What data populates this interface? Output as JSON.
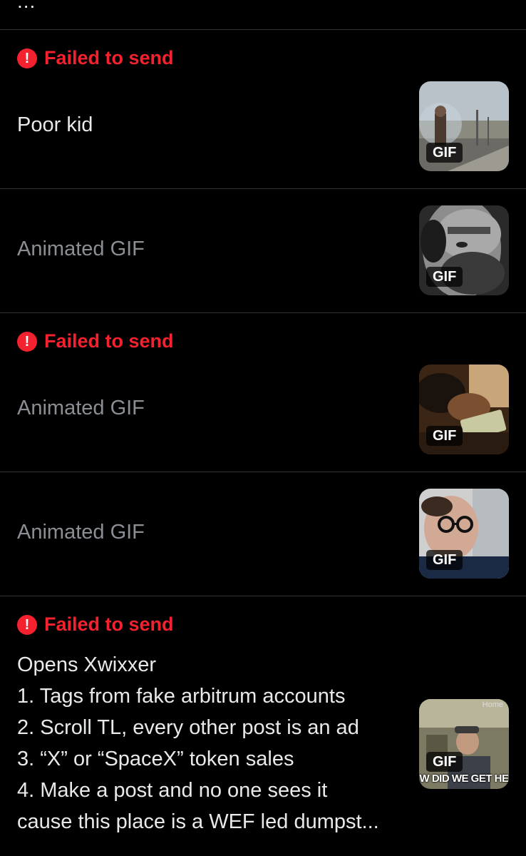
{
  "top": {
    "ellipsis": "..."
  },
  "messages": [
    {
      "failed_label": "Failed to send",
      "text": "Poor kid",
      "gif_badge": "GIF",
      "thumb_icon": "man-with-bubble-gif"
    },
    {
      "text": "Animated GIF",
      "gif_badge": "GIF",
      "thumb_icon": "bearded-man-gif"
    },
    {
      "failed_label": "Failed to send",
      "text": "Animated GIF",
      "gif_badge": "GIF",
      "thumb_icon": "money-counting-gif"
    },
    {
      "text": "Animated GIF",
      "gif_badge": "GIF",
      "thumb_icon": "man-with-glasses-gif"
    },
    {
      "failed_label": "Failed to send",
      "lines": [
        "Opens Xwixxer",
        "1. Tags from fake arbitrum accounts",
        "2. Scroll TL, every other post is an ad",
        "3. “X” or “SpaceX” token sales",
        "4. Make a post and no one sees it",
        "cause this place is a WEF led dumpst..."
      ],
      "gif_badge": "GIF",
      "thumb_caption": "W DID WE GET HE",
      "thumb_watermark": "Home",
      "thumb_icon": "old-man-gif"
    }
  ],
  "colors": {
    "error": "#f4212e",
    "text": "#e7e9ea",
    "muted": "#8b8f94",
    "divider": "#2f3336",
    "background": "#000000"
  }
}
